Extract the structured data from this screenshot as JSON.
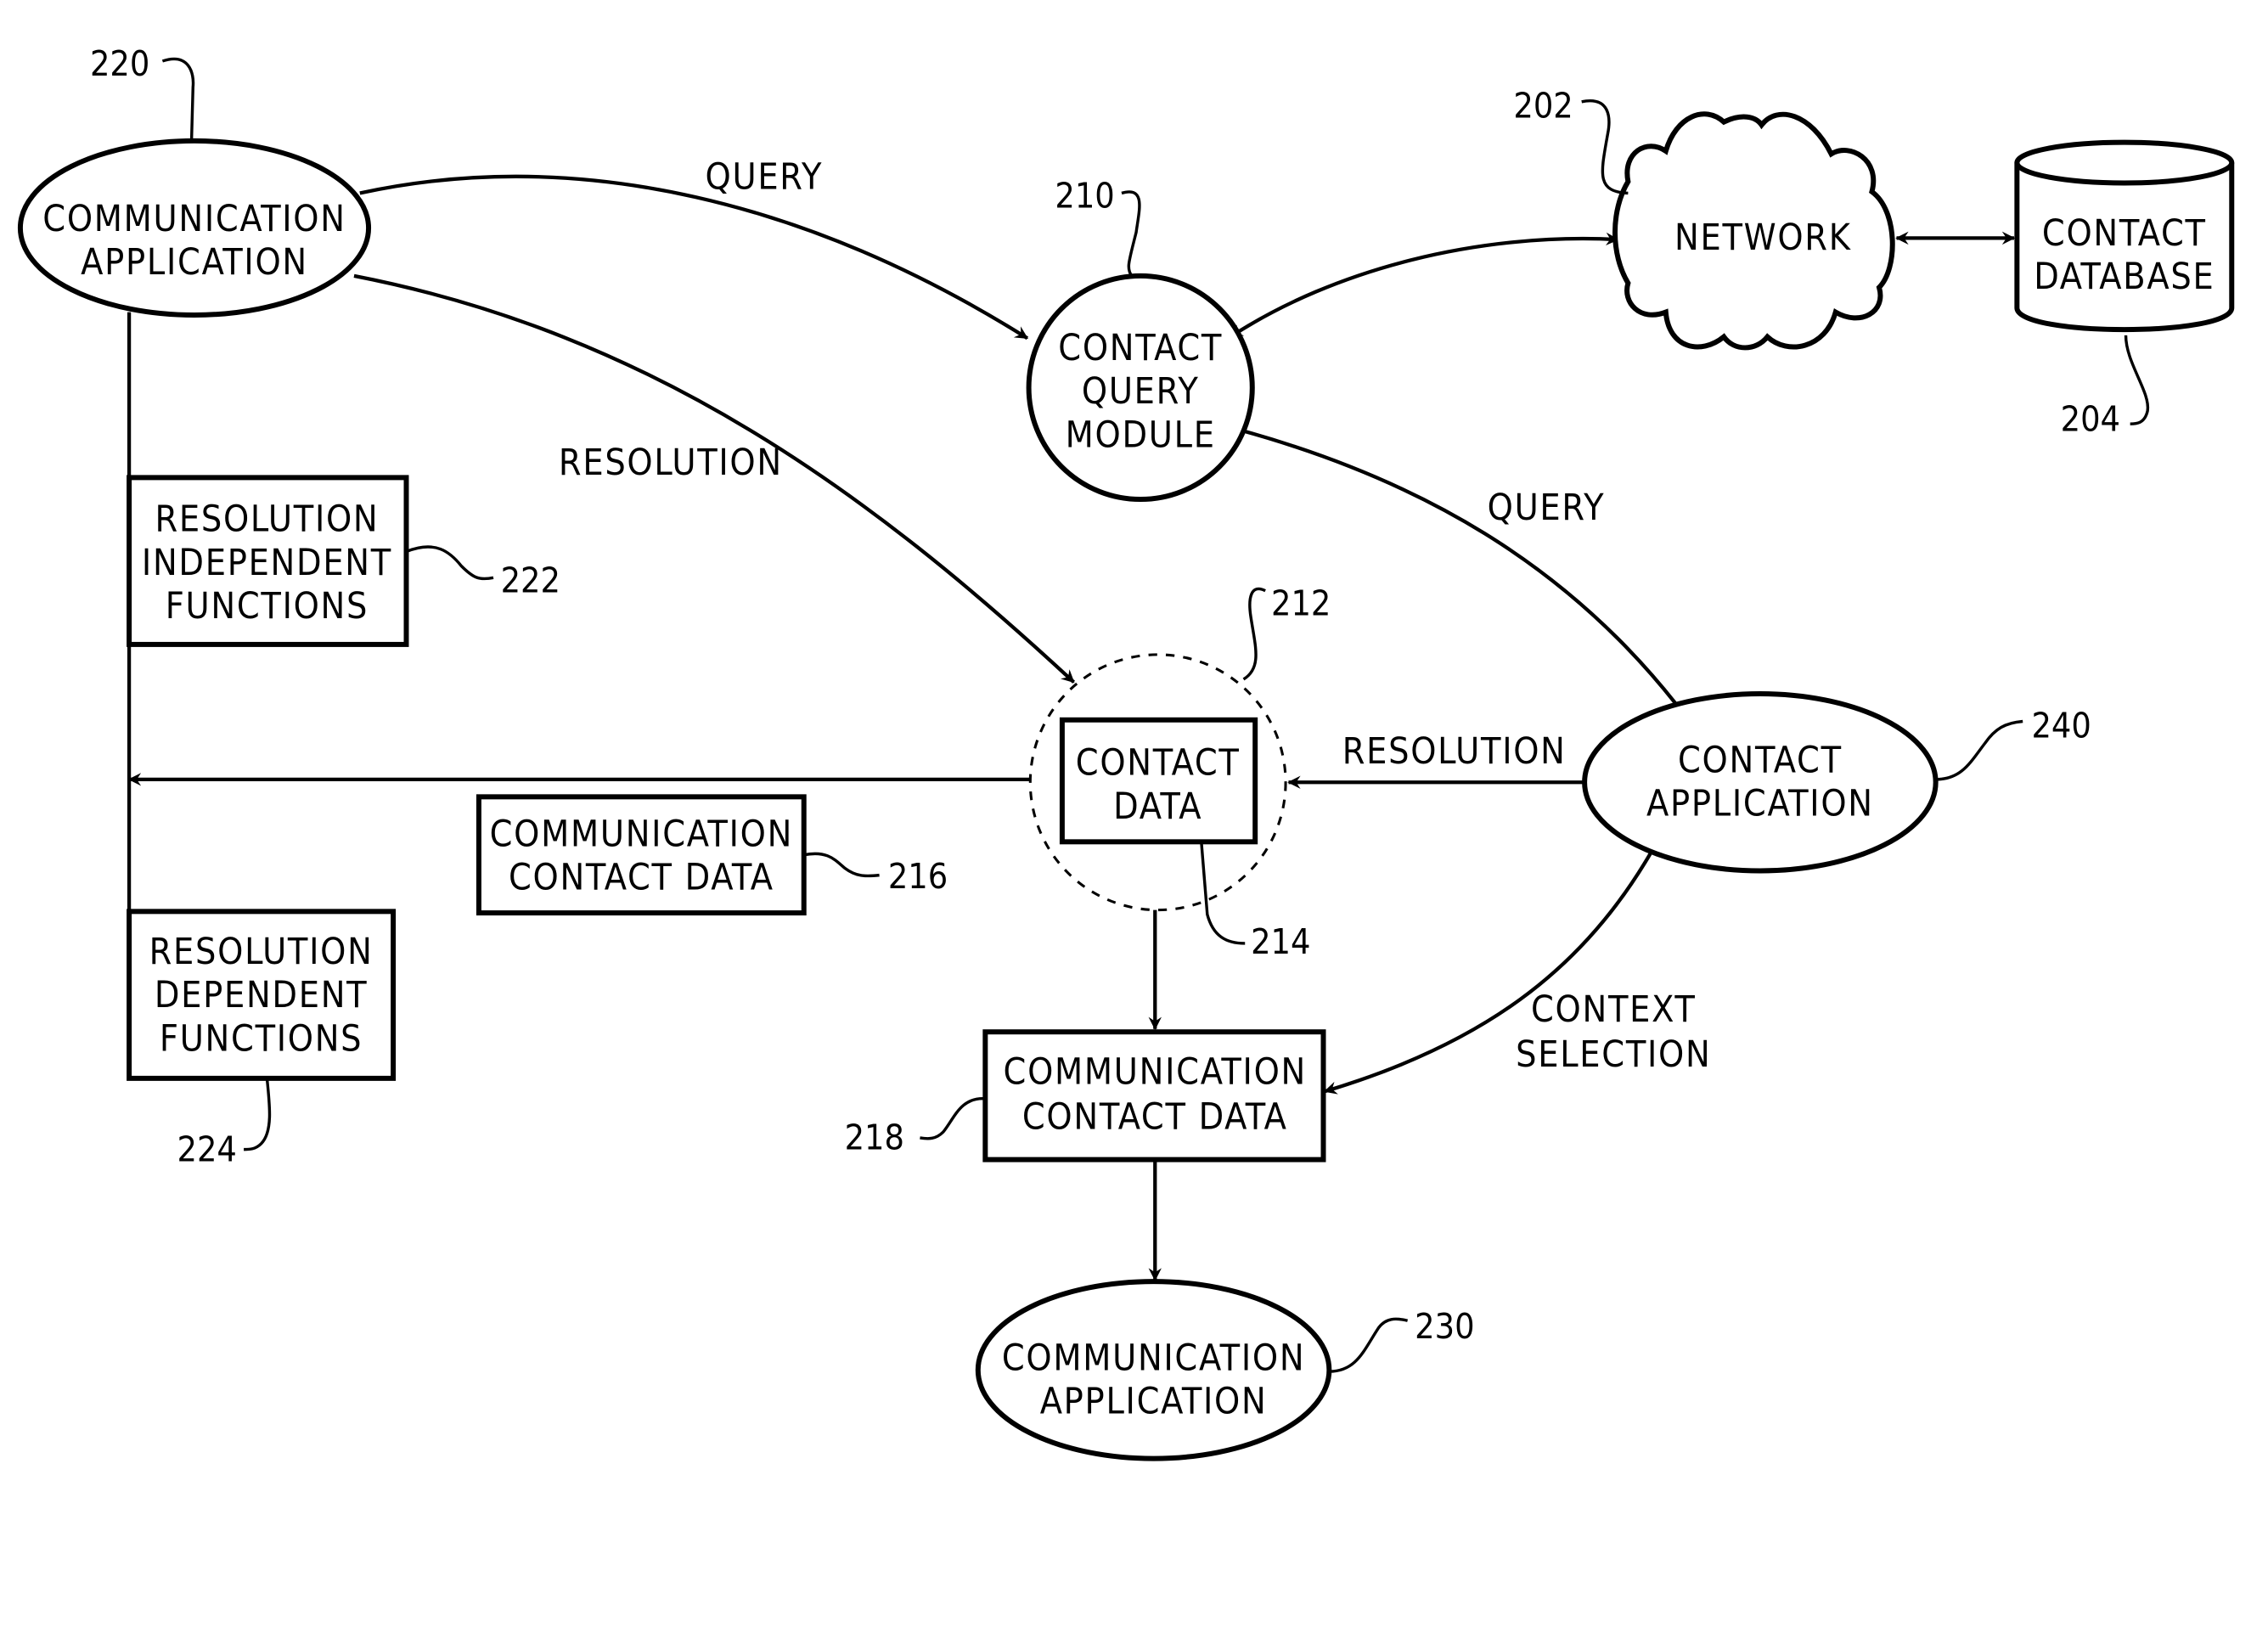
{
  "figure": {
    "nodes": {
      "comm_app_220": {
        "lines": [
          "COMMUNICATION",
          "APPLICATION"
        ],
        "ref": "220"
      },
      "contact_query_module_210": {
        "lines": [
          "CONTACT",
          "QUERY",
          "MODULE"
        ],
        "ref": "210"
      },
      "network_202": {
        "lines": [
          "NETWORK"
        ],
        "ref": "202"
      },
      "contact_database_204": {
        "lines": [
          "CONTACT",
          "DATABASE"
        ],
        "ref": "204"
      },
      "resolution_independent_222": {
        "lines": [
          "RESOLUTION",
          "INDEPENDENT",
          "FUNCTIONS"
        ],
        "ref": "222"
      },
      "resolution_dependent_224": {
        "lines": [
          "RESOLUTION",
          "DEPENDENT",
          "FUNCTIONS"
        ],
        "ref": "224"
      },
      "contact_data_group_212": {
        "ref": "212"
      },
      "contact_data_214": {
        "lines": [
          "CONTACT",
          "DATA"
        ],
        "ref": "214"
      },
      "comm_contact_data_216": {
        "lines": [
          "COMMUNICATION",
          "CONTACT DATA"
        ],
        "ref": "216"
      },
      "comm_contact_data_218": {
        "lines": [
          "COMMUNICATION",
          "CONTACT DATA"
        ],
        "ref": "218"
      },
      "comm_app_230": {
        "lines": [
          "COMMUNICATION",
          "APPLICATION"
        ],
        "ref": "230"
      },
      "contact_app_240": {
        "lines": [
          "CONTACT",
          "APPLICATION"
        ],
        "ref": "240"
      }
    },
    "edge_labels": {
      "query_top": "QUERY",
      "resolution_left": "RESOLUTION",
      "query_right": "QUERY",
      "resolution_right": "RESOLUTION",
      "context_selection": [
        "CONTEXT",
        "SELECTION"
      ]
    }
  }
}
